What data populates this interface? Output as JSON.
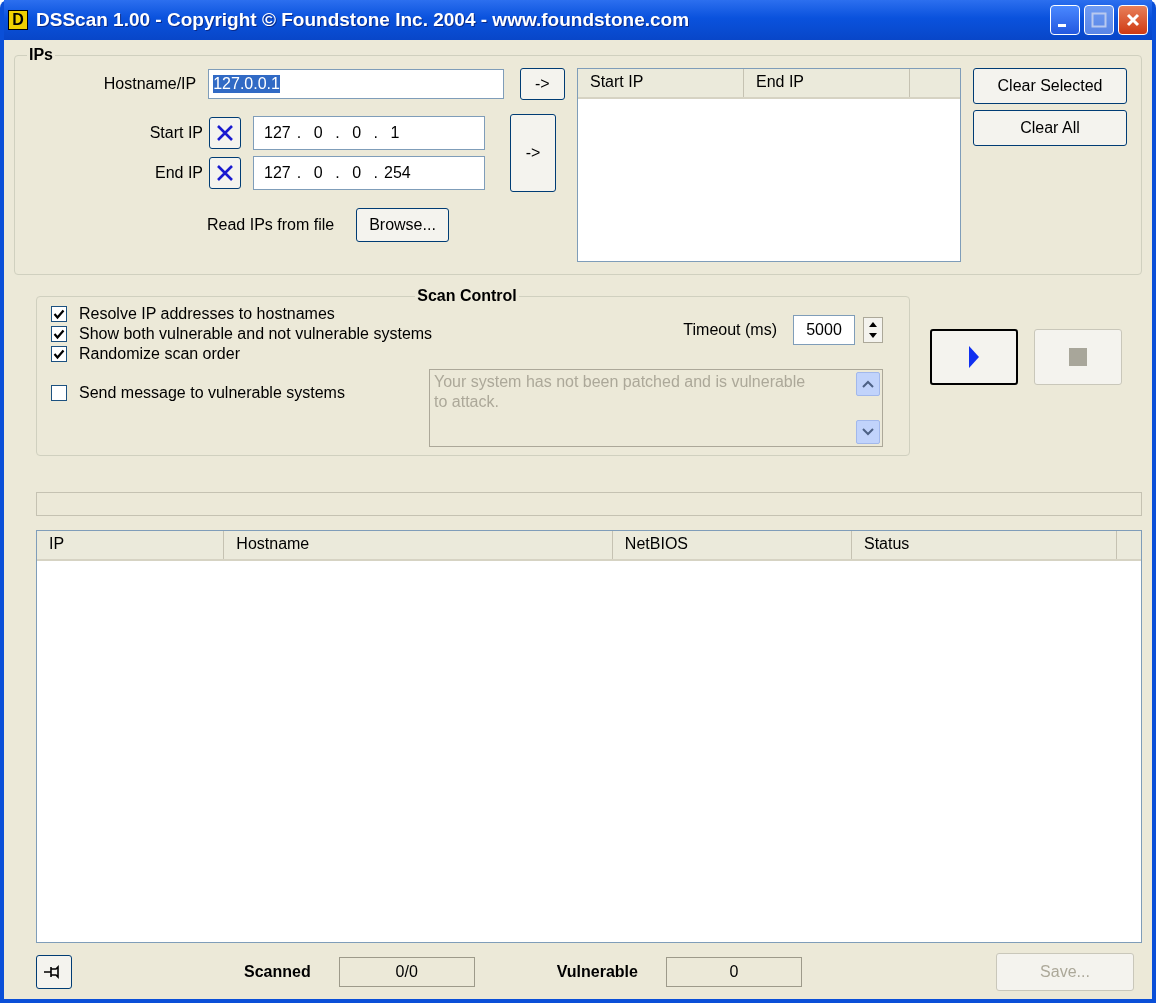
{
  "window": {
    "app_letter": "D",
    "title": "DSScan 1.00 - Copyright © Foundstone Inc. 2004 - www.foundstone.com"
  },
  "ips": {
    "title": "IPs",
    "hostname": {
      "label": "Hostname/IP",
      "value": "127.0.0.1",
      "selected": true
    },
    "add_host_button": "->",
    "start_ip": {
      "label": "Start IP",
      "octets": [
        "127",
        "0",
        "0",
        "1"
      ],
      "separator": "."
    },
    "end_ip": {
      "label": "End IP",
      "octets": [
        "127",
        "0",
        "0",
        "254"
      ],
      "separator": "."
    },
    "add_range_button": "->",
    "file_label": "Read IPs from file",
    "browse_button": "Browse...",
    "range_list": {
      "columns": [
        "Start IP",
        "End IP"
      ]
    },
    "clear_selected_button": "Clear Selected",
    "clear_all_button": "Clear All"
  },
  "scan_control": {
    "title": "Scan Control",
    "options": [
      {
        "label": "Resolve IP addresses to hostnames",
        "checked": true
      },
      {
        "label": "Show both vulnerable and not vulnerable systems",
        "checked": true
      },
      {
        "label": "Randomize scan order",
        "checked": true
      }
    ],
    "send_message": {
      "label": "Send message to vulnerable systems",
      "checked": false
    },
    "message": {
      "value": "Your system has not been patched and is vulnerable to attack.",
      "disabled": true
    },
    "timeout": {
      "label": "Timeout (ms)",
      "value": "5000"
    },
    "start": {
      "disabled": false
    },
    "stop": {
      "disabled": true
    }
  },
  "results": {
    "columns": [
      "IP",
      "Hostname",
      "NetBIOS",
      "Status"
    ]
  },
  "status_bar": {
    "scanned_label": "Scanned",
    "scanned": "0/0",
    "vulnerable_label": "Vulnerable",
    "vulnerable": "0",
    "save_button": {
      "label": "Save...",
      "disabled": true
    }
  }
}
